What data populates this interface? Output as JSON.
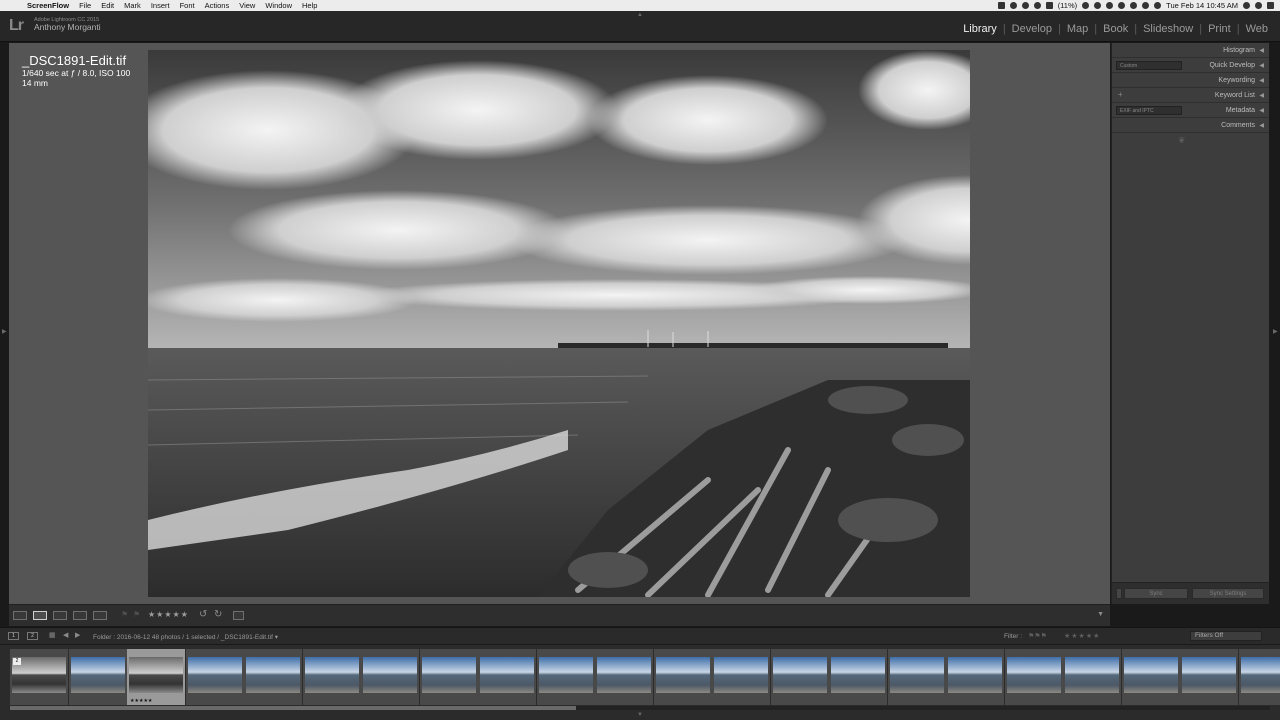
{
  "menubar": {
    "app": "ScreenFlow",
    "items": [
      "File",
      "Edit",
      "Mark",
      "Insert",
      "Font",
      "Actions",
      "View",
      "Window",
      "Help"
    ],
    "battery": "(11%)",
    "clock": "Tue Feb 14  10:45 AM"
  },
  "identity": {
    "logo": "Lr",
    "product": "Adobe Lightroom CC 2015",
    "user": "Anthony Morganti"
  },
  "modules": [
    "Library",
    "Develop",
    "Map",
    "Book",
    "Slideshow",
    "Print",
    "Web"
  ],
  "active_module": "Library",
  "info_overlay": {
    "filename": "_DSC1891-Edit.tif",
    "exif": "1/640 sec at ƒ / 8.0, ISO 100",
    "focal": "14 mm"
  },
  "right_panel": {
    "sections": [
      "Histogram",
      "Quick Develop",
      "Keywording",
      "Keyword List",
      "Metadata",
      "Comments"
    ],
    "quick_develop_preset": "Custom",
    "metadata_preset": "EXIF and IPTC",
    "sync_label": "Sync",
    "sync_settings_label": "Sync Settings"
  },
  "toolbar": {
    "stars": "★★★★★"
  },
  "filmstrip_bar": {
    "screen_1": "1",
    "screen_2": "2",
    "folder_path": "Folder : 2016-06-12     48 photos / 1 selected / _DSC1891-Edit.tif ▾",
    "filter_label": "Filter :",
    "filter_stars": "★★★★★",
    "filters_off": "Filters Off"
  },
  "filmstrip": {
    "stack_badge": "2",
    "selected_stars": "★★★★★",
    "selected_index": 2,
    "thumbnails": [
      {
        "tone": "bw"
      },
      {
        "tone": "color"
      },
      {
        "tone": "bw"
      },
      {
        "tone": "color"
      },
      {
        "tone": "color"
      },
      {
        "tone": "color"
      },
      {
        "tone": "color"
      },
      {
        "tone": "color"
      },
      {
        "tone": "color"
      },
      {
        "tone": "color"
      },
      {
        "tone": "color"
      },
      {
        "tone": "color"
      },
      {
        "tone": "color"
      },
      {
        "tone": "color"
      },
      {
        "tone": "color"
      },
      {
        "tone": "color"
      },
      {
        "tone": "color"
      },
      {
        "tone": "color"
      },
      {
        "tone": "color"
      },
      {
        "tone": "color"
      },
      {
        "tone": "color"
      },
      {
        "tone": "color"
      }
    ]
  },
  "colors": {
    "main_bg": "#555555",
    "panel_bg": "#3d3d3d",
    "active_module": "#f0f0f0"
  }
}
